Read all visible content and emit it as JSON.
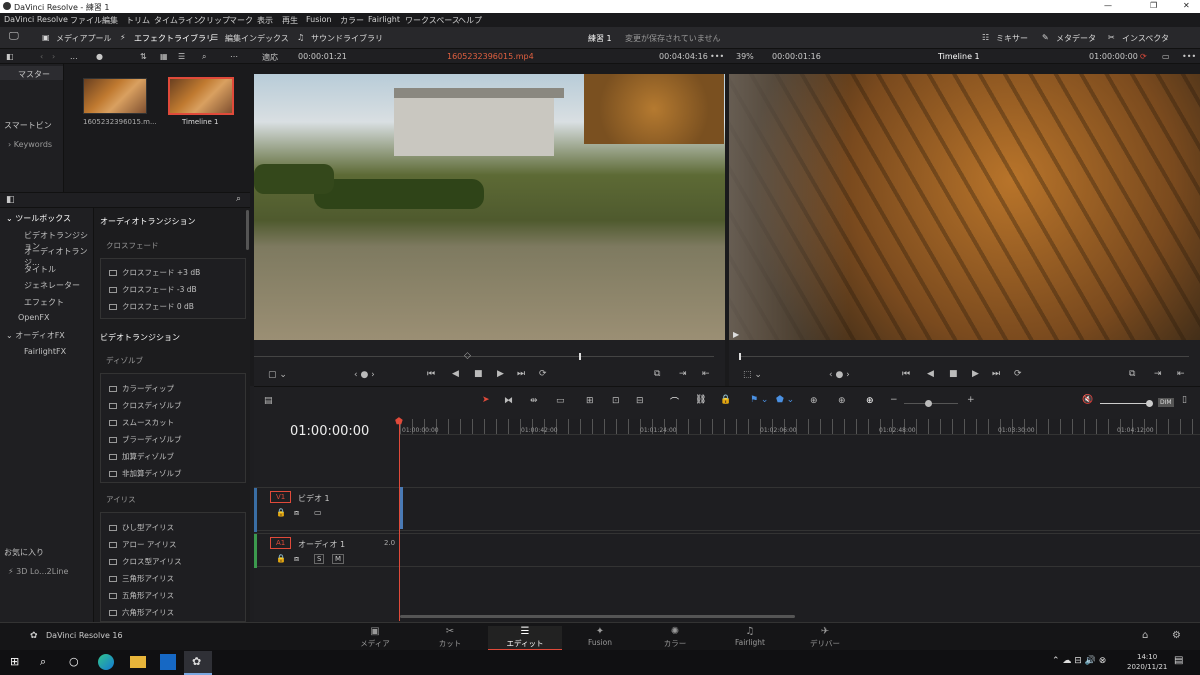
{
  "window": {
    "title": "DaVinci Resolve - 練習 1",
    "min": "—",
    "max": "❐",
    "close": "✕"
  },
  "menu": [
    "DaVinci Resolve",
    "ファイル",
    "編集",
    "トリム",
    "タイムライン",
    "クリップ",
    "マーク",
    "表示",
    "再生",
    "Fusion",
    "カラー",
    "Fairlight",
    "ワークスペース",
    "ヘルプ"
  ],
  "toolbar": {
    "media_pool": "メディアプール",
    "effects_library": "エフェクトライブラリ",
    "edit_index": "編集インデックス",
    "sound_library": "サウンドライブラリ",
    "project": "練習 1",
    "status": "変更が保存されていません",
    "mixer": "ミキサー",
    "metadata": "メタデータ",
    "inspector": "インスペクタ"
  },
  "strip": {
    "fit": "適応",
    "src_tc": "00:00:01:21",
    "clip_name": "1605232396015.mp4",
    "src_dur": "00:04:04:16",
    "zoom": "39%",
    "rec_tc": "00:00:01:16",
    "timeline_name": "Timeline 1",
    "tl_tc": "01:00:00:00",
    "dots": "•••"
  },
  "left": {
    "master": "マスター",
    "smart_bin": "スマートビン",
    "keywords": "Keywords",
    "favorites": "お気に入り",
    "fav_item": "3D Lo...2Line"
  },
  "media": {
    "clip1": "1605232396015.m...",
    "clip2": "Timeline 1"
  },
  "toolbox": {
    "title": "ツールボックス",
    "items": [
      "ビデオトランジション",
      "オーディオトランジ...",
      "タイトル",
      "ジェネレーター",
      "エフェクト",
      "OpenFX",
      "オーディオFX",
      "FairlightFX"
    ]
  },
  "fx": {
    "audio_title": "オーディオトランジション",
    "crossfade": "クロスフェード",
    "audio_items": [
      "クロスフェード +3 dB",
      "クロスフェード -3 dB",
      "クロスフェード 0 dB"
    ],
    "video_title": "ビデオトランジション",
    "dissolve": "ディゾルブ",
    "dissolve_items": [
      "カラーディップ",
      "クロスディゾルブ",
      "スムースカット",
      "ブラーディゾルブ",
      "加算ディゾルブ",
      "非加算ディゾルブ"
    ],
    "iris": "アイリス",
    "iris_items": [
      "ひし型アイリス",
      "アロー アイリス",
      "クロス型アイリス",
      "三角形アイリス",
      "五角形アイリス",
      "六角形アイリス"
    ]
  },
  "timeline": {
    "tc": "01:00:00:00",
    "ruler": [
      "01:00:00:00",
      "01:00:42:00",
      "01:01:24:00",
      "01:02:06:00",
      "01:02:48:00",
      "01:03:30:00",
      "01:04:12:00"
    ],
    "v1": "V1",
    "video1": "ビデオ 1",
    "a1": "A1",
    "audio1": "オーディオ 1",
    "a1_level": "2.0",
    "s": "S",
    "m": "M",
    "dim": "DIM"
  },
  "nav": {
    "app": "DaVinci Resolve 16",
    "pages": [
      "メディア",
      "カット",
      "エディット",
      "Fusion",
      "カラー",
      "Fairlight",
      "デリバー"
    ]
  },
  "taskbar": {
    "time": "14:10",
    "date": "2020/11/21"
  },
  "colors": {
    "accent_red": "#e04a3a",
    "active_tab": "#e04a3a",
    "clip_name": "#e06040"
  }
}
